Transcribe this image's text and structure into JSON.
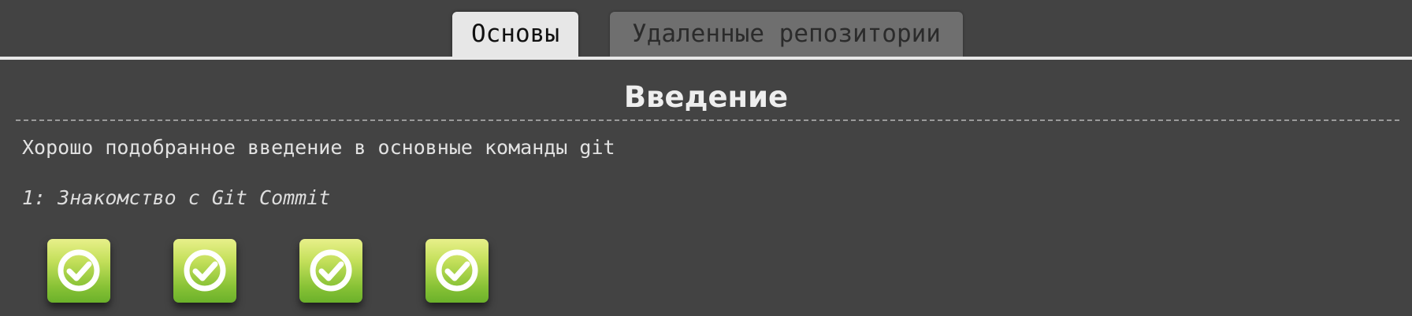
{
  "tabs": {
    "active_label": "Основы",
    "inactive_label": "Удаленные репозитории"
  },
  "sequence": {
    "title": "Введение",
    "about": "Хорошо подобранное введение в основные команды git",
    "selected_level": "1: Знакомство с Git Commit"
  },
  "levels": [
    {
      "icon": "check-icon",
      "status": "completed"
    },
    {
      "icon": "check-icon",
      "status": "completed"
    },
    {
      "icon": "check-icon",
      "status": "completed"
    },
    {
      "icon": "check-icon",
      "status": "completed"
    }
  ],
  "colors": {
    "background": "#434343",
    "active_tab": "#e7e7e7",
    "inactive_tab": "#6f6f6f",
    "level_complete": "#88c236"
  }
}
